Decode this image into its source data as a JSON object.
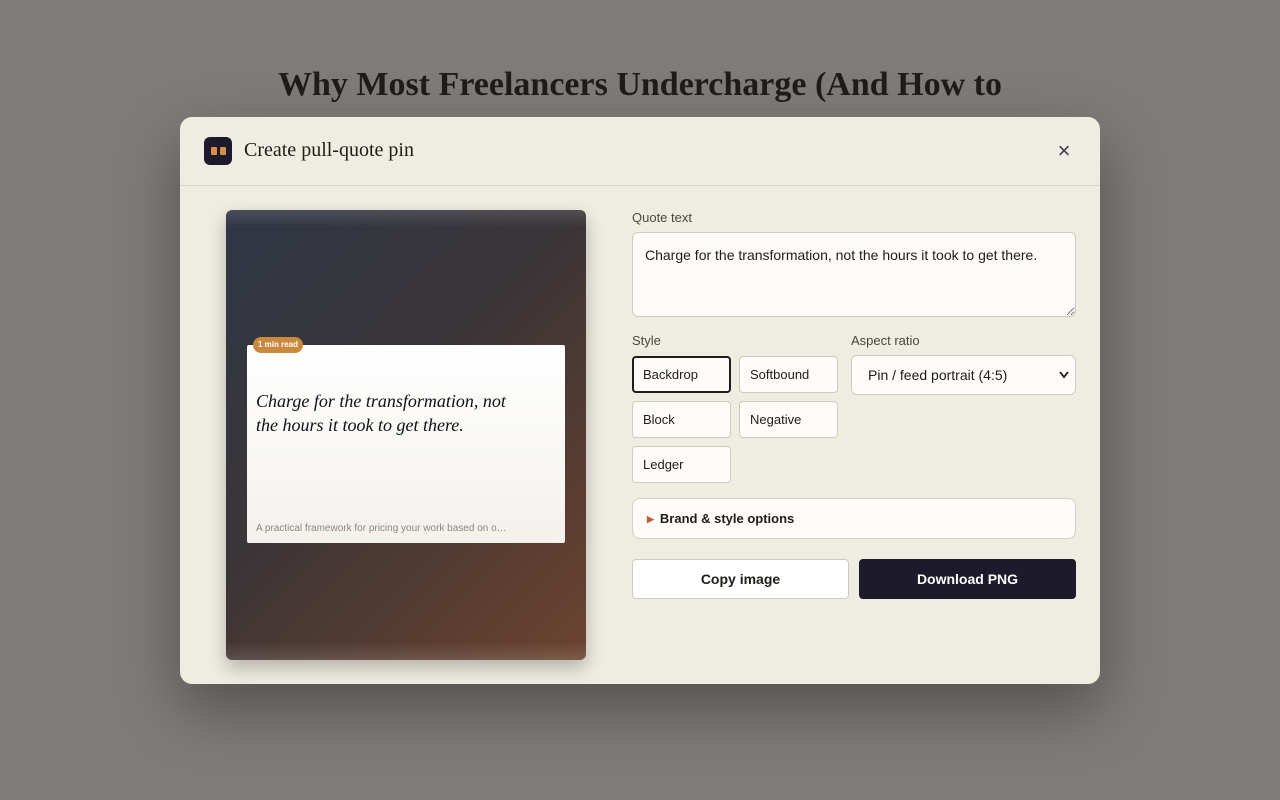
{
  "page": {
    "title": "Why Most Freelancers Undercharge (And How to"
  },
  "modal": {
    "title": "Create pull-quote pin",
    "close_icon": "×"
  },
  "preview": {
    "badge": "1 min read",
    "quote": "Charge for the transformation, not the hours it took to get there.",
    "subtitle": "A practical framework for pricing your work based on o…"
  },
  "form": {
    "quote_label": "Quote text",
    "quote_value": "Charge for the transformation, not the hours it took to get there.",
    "style_label": "Style",
    "styles": [
      {
        "label": "Backdrop",
        "selected": true
      },
      {
        "label": "Softbound",
        "selected": false
      },
      {
        "label": "Block",
        "selected": false
      },
      {
        "label": "Negative",
        "selected": false
      },
      {
        "label": "Ledger",
        "selected": false
      }
    ],
    "aspect_label": "Aspect ratio",
    "aspect_value": "Pin / feed portrait (4:5)",
    "brand_options": "Brand & style options",
    "copy_button": "Copy image",
    "download_button": "Download PNG"
  },
  "colors": {
    "accent": "#1c1a2b",
    "badge": "#c98a3f",
    "modal_bg": "#efece2"
  },
  "icons": {
    "app": "pull-quote-icon",
    "close": "close-icon",
    "disclosure": "triangle-right-icon",
    "select": "chevron-down-icon"
  }
}
